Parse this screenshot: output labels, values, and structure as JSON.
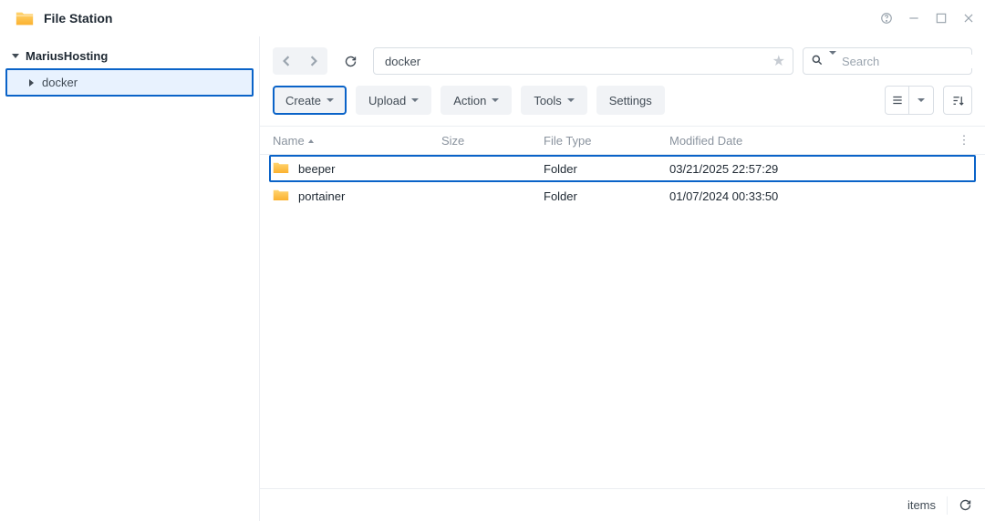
{
  "app": {
    "title": "File Station"
  },
  "sidebar": {
    "root": "MariusHosting",
    "item": "docker"
  },
  "path": "docker",
  "search": {
    "placeholder": "Search"
  },
  "toolbar": {
    "create": "Create",
    "upload": "Upload",
    "action": "Action",
    "tools": "Tools",
    "settings": "Settings"
  },
  "columns": {
    "name": "Name",
    "size": "Size",
    "type": "File Type",
    "date": "Modified Date"
  },
  "rows": [
    {
      "name": "beeper",
      "type": "Folder",
      "date": "03/21/2025 22:57:29",
      "highlighted": true
    },
    {
      "name": "portainer",
      "type": "Folder",
      "date": "01/07/2024 00:33:50",
      "highlighted": false
    }
  ],
  "status": {
    "items_label": "items"
  }
}
